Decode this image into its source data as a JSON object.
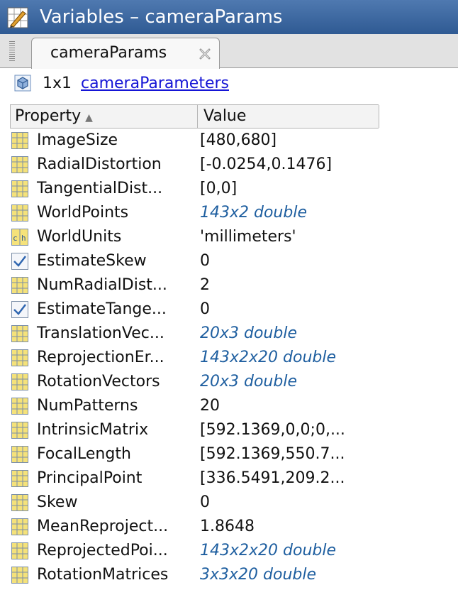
{
  "window": {
    "title": "Variables – cameraParams"
  },
  "tabs": [
    {
      "label": "cameraParams"
    }
  ],
  "info": {
    "dims": "1x1",
    "class_name": "cameraParameters"
  },
  "table": {
    "headers": {
      "property": "Property",
      "value": "Value"
    },
    "rows": [
      {
        "icon": "grid",
        "name": "ImageSize",
        "value": "[480,680]",
        "link": false
      },
      {
        "icon": "grid",
        "name": "RadialDistortion",
        "value": "[-0.0254,0.1476]",
        "link": false
      },
      {
        "icon": "grid",
        "name": "TangentialDist...",
        "value": "[0,0]",
        "link": false
      },
      {
        "icon": "grid",
        "name": "WorldPoints",
        "value": "143x2 double",
        "link": true
      },
      {
        "icon": "char",
        "name": "WorldUnits",
        "value": "'millimeters'",
        "link": false
      },
      {
        "icon": "check",
        "name": "EstimateSkew",
        "value": "0",
        "link": false
      },
      {
        "icon": "grid",
        "name": "NumRadialDist...",
        "value": "2",
        "link": false
      },
      {
        "icon": "check",
        "name": "EstimateTange...",
        "value": "0",
        "link": false
      },
      {
        "icon": "grid",
        "name": "TranslationVec...",
        "value": "20x3 double",
        "link": true
      },
      {
        "icon": "grid",
        "name": "ReprojectionEr...",
        "value": "143x2x20 double",
        "link": true
      },
      {
        "icon": "grid",
        "name": "RotationVectors",
        "value": "20x3 double",
        "link": true
      },
      {
        "icon": "grid",
        "name": "NumPatterns",
        "value": "20",
        "link": false
      },
      {
        "icon": "grid",
        "name": "IntrinsicMatrix",
        "value": "[592.1369,0,0;0,...",
        "link": false
      },
      {
        "icon": "grid",
        "name": "FocalLength",
        "value": "[592.1369,550.7...",
        "link": false
      },
      {
        "icon": "grid",
        "name": "PrincipalPoint",
        "value": "[336.5491,209.2...",
        "link": false
      },
      {
        "icon": "grid",
        "name": "Skew",
        "value": "0",
        "link": false
      },
      {
        "icon": "grid",
        "name": "MeanReproject...",
        "value": "1.8648",
        "link": false
      },
      {
        "icon": "grid",
        "name": "ReprojectedPoi...",
        "value": "143x2x20 double",
        "link": true
      },
      {
        "icon": "grid",
        "name": "RotationMatrices",
        "value": "3x3x20 double",
        "link": true
      }
    ]
  },
  "colors": {
    "titlebar": "#3d679f",
    "link_value": "#1f5fa0",
    "class_link": "#1515d6",
    "icon_fill": "#f5e27a"
  }
}
